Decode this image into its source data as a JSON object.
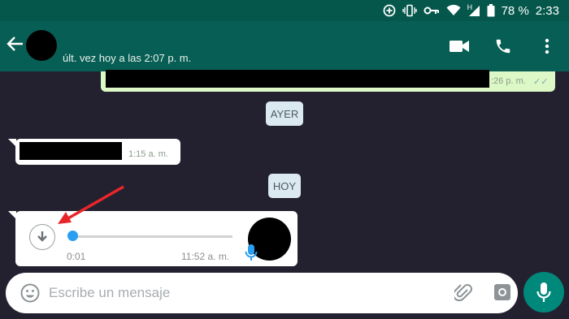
{
  "status_bar": {
    "battery": "78 %",
    "time": "2:33",
    "network_letter": "H",
    "icons": [
      "data-saver-icon",
      "vibrate-icon",
      "vpn-key-icon",
      "wifi-icon",
      "signal-icon",
      "battery-icon"
    ]
  },
  "header": {
    "last_seen": "últ. vez hoy a las 2:07 p. m.",
    "icons": [
      "back-arrow-icon",
      "video-call-icon",
      "phone-icon",
      "more-options-icon"
    ]
  },
  "messages": [
    {
      "type": "outgoing",
      "time": ":26 p. m.",
      "ticks": "✓✓"
    },
    {
      "type": "date",
      "label": "AYER"
    },
    {
      "type": "incoming",
      "time": "1:15 a. m."
    },
    {
      "type": "date",
      "label": "HOY"
    },
    {
      "type": "incoming-voice",
      "duration": "0:01",
      "time": "11:52 a. m.",
      "playback_progress": 0
    }
  ],
  "composer": {
    "placeholder": "Escribe un mensaje",
    "icons": [
      "emoji-icon",
      "attach-icon",
      "camera-icon",
      "mic-icon"
    ]
  },
  "colors": {
    "header": "#075e54",
    "status_bar": "#05574c",
    "chat_bg": "#232130",
    "outgoing_bubble": "#dcf8c6",
    "date_chip": "#dbe9f0",
    "mic_button": "#00897b",
    "annotation_arrow": "#e8262a"
  }
}
